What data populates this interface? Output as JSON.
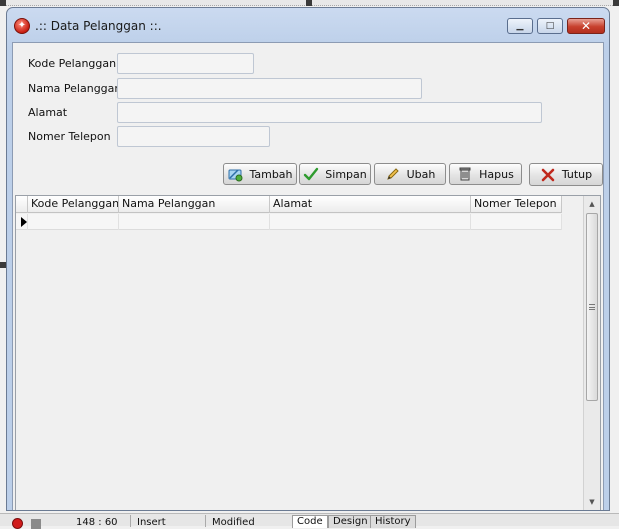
{
  "window": {
    "title": ".:: Data Pelanggan ::.",
    "minimize_symbol": "▁",
    "maximize_symbol": "□",
    "close_symbol": "✕"
  },
  "form": {
    "fields": [
      {
        "label": "Kode Pelanggan",
        "value": "",
        "placeholder": ""
      },
      {
        "label": "Nama Pelanggan",
        "value": "",
        "placeholder": ""
      },
      {
        "label": "Alamat",
        "value": "",
        "placeholder": ""
      },
      {
        "label": "Nomer Telepon",
        "value": "",
        "placeholder": ""
      }
    ]
  },
  "buttons": {
    "tambah": "Tambah",
    "simpan": "Simpan",
    "ubah": "Ubah",
    "hapus": "Hapus",
    "tutup": "Tutup"
  },
  "table": {
    "columns": [
      "Kode Pelanggan",
      "Nama Pelanggan",
      "Alamat",
      "Nomer Telepon"
    ],
    "rows": [
      [
        "",
        "",
        "",
        ""
      ]
    ]
  },
  "statusbar": {
    "position": "148 : 60",
    "mode": "Insert",
    "state": "Modified",
    "tabs": [
      "Code",
      "Design",
      "History"
    ]
  },
  "icons": {
    "app": "app-logo-icon",
    "tambah": "add-record-icon",
    "simpan": "checkmark-icon",
    "ubah": "pencil-icon",
    "hapus": "trash-icon",
    "tutup": "close-x-icon"
  },
  "colors": {
    "title_gradient_top": "#cbdaf0",
    "close_button": "#c7402d",
    "check_green": "#2e9b2e",
    "close_x_red": "#c0281c"
  }
}
